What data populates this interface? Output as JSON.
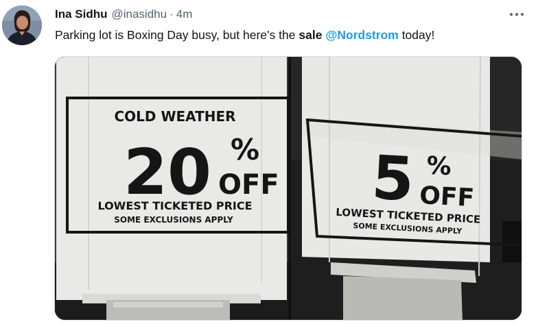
{
  "author": {
    "name": "Ina Sidhu",
    "handle": "@inasidhu",
    "separator": "·",
    "time": "4m"
  },
  "tweet": {
    "text_start": "Parking lot is Boxing Day busy, but here’s the ",
    "text_bold": "sale",
    "text_space": " ",
    "mention": "@Nordstrom",
    "text_end": " today!"
  },
  "icons": {
    "more": "more-horizontal-icon"
  },
  "photos": [
    {
      "heading": "COLD WEATHER",
      "number": "20",
      "percent": "%",
      "off": "OFF",
      "line1": "LOWEST TICKETED PRICE",
      "line2": "SOME EXCLUSIONS APPLY"
    },
    {
      "number": "5",
      "percent": "%",
      "off": "OFF",
      "line1": "LOWEST TICKETED PRICE",
      "line2": "SOME EXCLUSIONS APPLY"
    }
  ],
  "colors": {
    "mention": "#1d9bf0",
    "secondary_text": "#536471",
    "primary_text": "#0f1419"
  }
}
